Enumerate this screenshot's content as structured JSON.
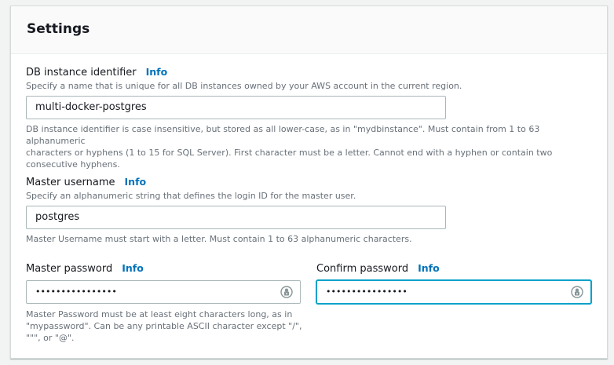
{
  "settings": {
    "title": "Settings",
    "info_label": "Info",
    "db_identifier": {
      "label": "DB instance identifier",
      "description": "Specify a name that is unique for all DB instances owned by your AWS account in the current region.",
      "value": "multi-docker-postgres",
      "constraint_line1": "DB instance identifier is case insensitive, but stored as all lower-case, as in \"mydbinstance\". Must contain from 1 to 63 alphanumeric",
      "constraint_line2": "characters or hyphens (1 to 15 for SQL Server). First character must be a letter. Cannot end with a hyphen or contain two",
      "constraint_line3": "consecutive hyphens."
    },
    "master_username": {
      "label": "Master username",
      "description": "Specify an alphanumeric string that defines the login ID for the master user.",
      "value": "postgres",
      "constraint": "Master Username must start with a letter. Must contain 1 to 63 alphanumeric characters."
    },
    "master_password": {
      "label": "Master password",
      "value": "••••••••••••••••",
      "constraint_line1": "Master Password must be at least eight characters long, as in",
      "constraint_line2": "\"mypassword\". Can be any printable ASCII character except \"/\",",
      "constraint_line3": "\"\"\", or \"@\"."
    },
    "confirm_password": {
      "label": "Confirm password",
      "value": "••••••••••••••••"
    }
  },
  "colors": {
    "link": "#0073bb",
    "focus_border": "#00a1c9",
    "hint_text": "#687078"
  },
  "icons": {
    "password_manager": "key-lock-icon"
  }
}
